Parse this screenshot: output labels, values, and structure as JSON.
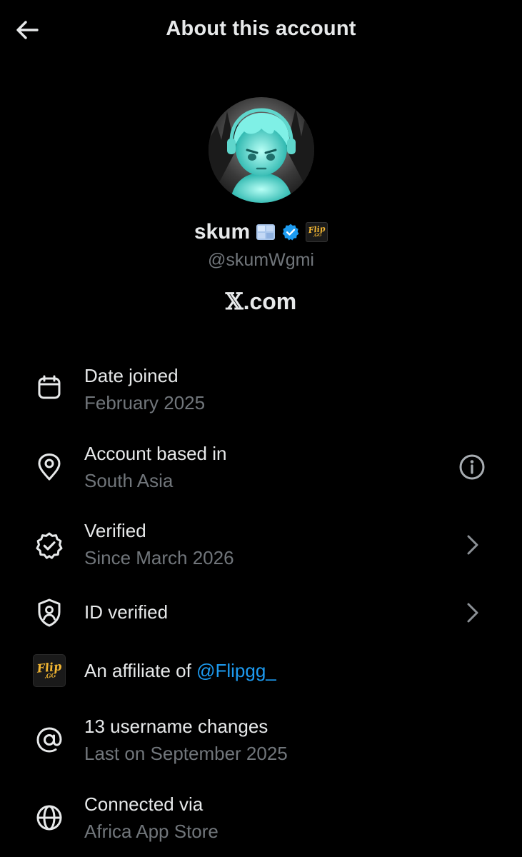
{
  "header": {
    "title": "About this account",
    "back_icon": "arrow-left-icon"
  },
  "profile": {
    "display_name": "skum",
    "name_badges": [
      "ice-cube-emoji",
      "verified-badge",
      "flip-gg-affiliate-badge"
    ],
    "handle": "@skumWgmi",
    "site_x": "𝕏",
    "site_rest": ".com",
    "badge_logo_word": "Flip",
    "badge_logo_suffix": ".GG"
  },
  "rows": [
    {
      "title": "Date joined",
      "subtitle": "February 2025",
      "icon": "calendar-icon"
    },
    {
      "title": "Account based in",
      "subtitle": "South Asia",
      "icon": "location-pin-icon",
      "trail": "info-icon"
    },
    {
      "title": "Verified",
      "subtitle": "Since March 2026",
      "icon": "verified-check-icon",
      "trail": "chevron-right-icon"
    },
    {
      "title": "ID verified",
      "icon": "id-shield-icon",
      "trail": "chevron-right-icon"
    },
    {
      "title": "An affiliate of ",
      "link": "@Flipgg_",
      "icon": "flip-gg-logo",
      "logo_word": "Flip",
      "logo_suffix": ".GG"
    },
    {
      "title": "13 username changes",
      "subtitle": "Last on September 2025",
      "icon": "at-sign-icon"
    },
    {
      "title": "Connected via",
      "subtitle": "Africa App Store",
      "icon": "globe-icon"
    }
  ],
  "colors": {
    "background": "#000000",
    "primary_text": "#e7e9ea",
    "secondary_text": "#71767b",
    "link": "#1d9bf0",
    "verified": "#1d9bf0",
    "flip_gold": "#f2b632"
  }
}
